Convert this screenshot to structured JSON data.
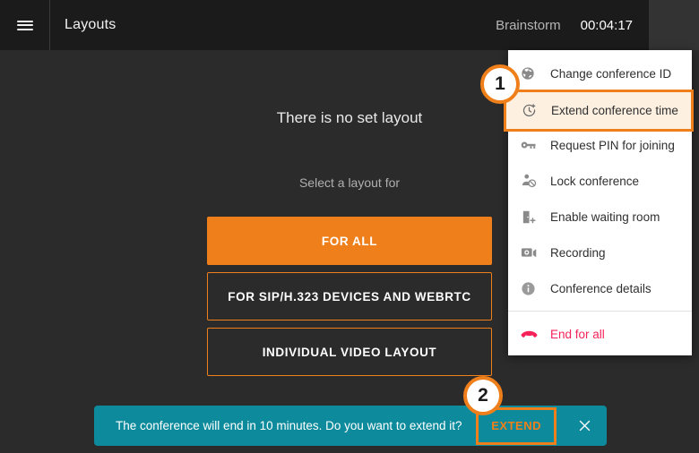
{
  "topbar": {
    "menu_icon": "hamburger-icon",
    "title": "Layouts",
    "conference_name": "Brainstorm",
    "timer": "00:04:17",
    "overflow_icon": "kebab-menu-icon"
  },
  "main": {
    "no_layout_title": "There is no set layout",
    "select_layout_subtitle": "Select a layout for",
    "buttons": [
      {
        "label": "FOR ALL",
        "style": "primary"
      },
      {
        "label": "FOR SIP/H.323 DEVICES AND WEBRTC",
        "style": "outline"
      },
      {
        "label": "INDIVIDUAL VIDEO LAYOUT",
        "style": "outline"
      }
    ]
  },
  "menu": {
    "items": [
      {
        "label": "Change conference ID",
        "icon": "globe-icon"
      },
      {
        "label": "Extend conference time",
        "icon": "clock-plus-icon",
        "highlighted": true
      },
      {
        "label": "Request PIN for joining",
        "icon": "key-icon"
      },
      {
        "label": "Lock conference",
        "icon": "person-block-icon"
      },
      {
        "label": "Enable waiting room",
        "icon": "door-plus-icon"
      },
      {
        "label": "Recording",
        "icon": "video-camera-icon"
      },
      {
        "label": "Conference details",
        "icon": "info-icon"
      }
    ],
    "end_item": {
      "label": "End for all",
      "icon": "hangup-phone-icon"
    }
  },
  "toast": {
    "message": "The conference will end in 10 minutes. Do you want to extend it?",
    "action_label": "EXTEND",
    "close_icon": "close-icon"
  },
  "callouts": [
    {
      "number": "1"
    },
    {
      "number": "2"
    }
  ],
  "colors": {
    "accent_orange": "#ef7f1a",
    "toast_teal": "#0d8b9c",
    "danger_red": "#f5225a",
    "background": "#2b2b2b",
    "topbar": "#1b1b1b",
    "menu_highlight": "#fdf0e1"
  }
}
